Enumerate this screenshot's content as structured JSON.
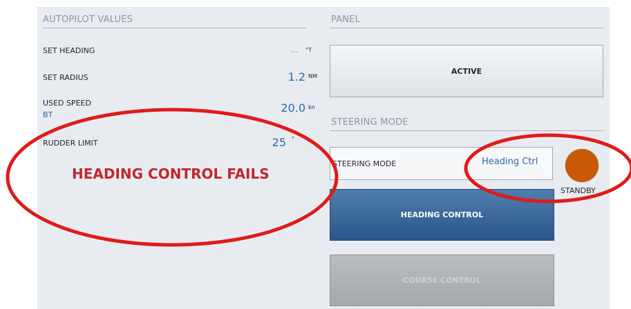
{
  "autopilot": {
    "title": "AUTOPILOT VALUES",
    "set_heading": {
      "label": "SET HEADING",
      "value": "---",
      "unit": "°T"
    },
    "set_radius": {
      "label": "SET RADIUS",
      "value": "1.2",
      "unit": "NM"
    },
    "used_speed": {
      "label": "USED SPEED",
      "sub": "BT",
      "value": "20.0",
      "unit": "kn"
    },
    "rudder_limit": {
      "label": "RUDDER LIMIT",
      "value": "25",
      "unit": "°"
    }
  },
  "panel": {
    "title": "PANEL",
    "active_button": "ACTIVE"
  },
  "steering": {
    "title": "STEERING MODE",
    "mode_label": "STEERING MODE",
    "mode_value": "Heading Ctrl",
    "status": "STANDBY",
    "status_color": "#c85a06",
    "heading_button": "HEADING CONTROL",
    "course_button": "COURSE CONTROL"
  },
  "annotation": {
    "text": "HEADING CONTROL FAILS",
    "color": "#c0282d",
    "ellipse_color": "#e01b1b"
  }
}
